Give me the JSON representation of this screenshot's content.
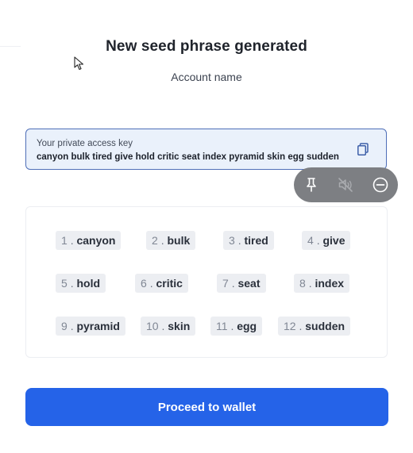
{
  "header": {
    "title": "New seed phrase generated",
    "account_name": "Account name"
  },
  "key": {
    "label": "Your private access key",
    "phrase": "canyon bulk tired give hold critic seat index pyramid skin egg sudden",
    "copy_icon": "copy-icon"
  },
  "media_controls": {
    "icons": [
      "pin-icon",
      "mute-icon",
      "minus-circle-icon"
    ],
    "background": "#7d7f83"
  },
  "words": [
    {
      "num": "1",
      "word": "canyon"
    },
    {
      "num": "2",
      "word": "bulk"
    },
    {
      "num": "3",
      "word": "tired"
    },
    {
      "num": "4",
      "word": "give"
    },
    {
      "num": "5",
      "word": "hold"
    },
    {
      "num": "6",
      "word": "critic"
    },
    {
      "num": "7",
      "word": "seat"
    },
    {
      "num": "8",
      "word": "index"
    },
    {
      "num": "9",
      "word": "pyramid"
    },
    {
      "num": "10",
      "word": "skin"
    },
    {
      "num": "11",
      "word": "egg"
    },
    {
      "num": "12",
      "word": "sudden"
    }
  ],
  "footer": {
    "proceed_label": "Proceed to wallet"
  },
  "colors": {
    "accent": "#2563e8",
    "key_border": "#4f6fb8",
    "key_background": "#eaf1fb",
    "chip_background": "#eceef2"
  }
}
